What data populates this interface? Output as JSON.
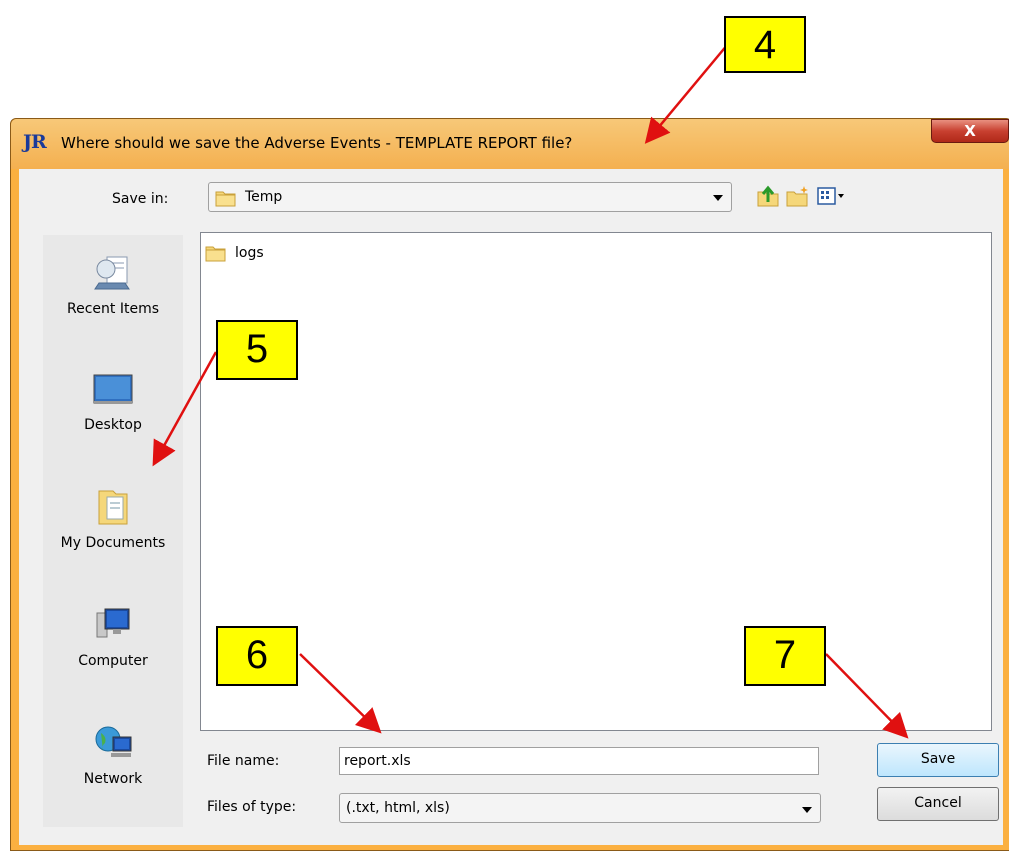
{
  "window": {
    "app_logo": "JR",
    "title": "Where should we save the Adverse Events - TEMPLATE  REPORT file?",
    "close_label": "X"
  },
  "save_in": {
    "label": "Save in:",
    "value": "Temp"
  },
  "toolbar": {
    "icons": [
      "up-folder-icon",
      "new-folder-icon",
      "view-menu-icon"
    ]
  },
  "places": [
    {
      "label": "Recent Items",
      "icon": "recent-items-icon"
    },
    {
      "label": "Desktop",
      "icon": "desktop-icon"
    },
    {
      "label": "My Documents",
      "icon": "my-documents-icon"
    },
    {
      "label": "Computer",
      "icon": "computer-icon"
    },
    {
      "label": "Network",
      "icon": "network-icon"
    }
  ],
  "files": [
    {
      "name": "logs",
      "icon": "folder-icon"
    }
  ],
  "file_name": {
    "label": "File name:",
    "value": "report.xls"
  },
  "file_type": {
    "label": "Files of type:",
    "value": "(.txt, html, xls)"
  },
  "buttons": {
    "save": "Save",
    "cancel": "Cancel"
  },
  "callouts": [
    "4",
    "5",
    "6",
    "7"
  ],
  "colors": {
    "callout_fill": "#ffff00",
    "arrow": "#e01010",
    "frame": "#fbb040"
  }
}
